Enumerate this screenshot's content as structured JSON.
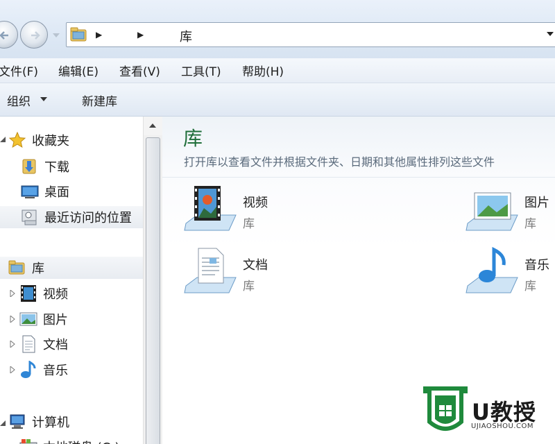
{
  "address_bar": {
    "crumbs": [
      "库"
    ]
  },
  "menu": {
    "items": [
      "文件(F)",
      "编辑(E)",
      "查看(V)",
      "工具(T)",
      "帮助(H)"
    ]
  },
  "toolbar": {
    "organize": "组织",
    "new_library": "新建库"
  },
  "nav": {
    "favorites": "收藏夹",
    "favorites_items": [
      "下载",
      "桌面",
      "最近访问的位置"
    ],
    "libraries": "库",
    "library_items": [
      "视频",
      "图片",
      "文档",
      "音乐"
    ],
    "computer": "计算机",
    "computer_items": [
      "本地磁盘 (C:)"
    ]
  },
  "content": {
    "title": "库",
    "description": "打开库以查看文件并根据文件夹、日期和其他属性排列这些文件",
    "libraries": [
      {
        "name": "视频",
        "type": "库",
        "icon": "video-library-icon"
      },
      {
        "name": "图片",
        "type": "库",
        "icon": "pictures-library-icon"
      },
      {
        "name": "文档",
        "type": "库",
        "icon": "documents-library-icon"
      },
      {
        "name": "音乐",
        "type": "库",
        "icon": "music-library-icon"
      }
    ]
  },
  "watermark": {
    "brand": "U教授",
    "url": "UJIAOSHOU.COM"
  },
  "colors": {
    "title_green": "#1f6e3a",
    "watermark_green": "#1f8a3c"
  }
}
